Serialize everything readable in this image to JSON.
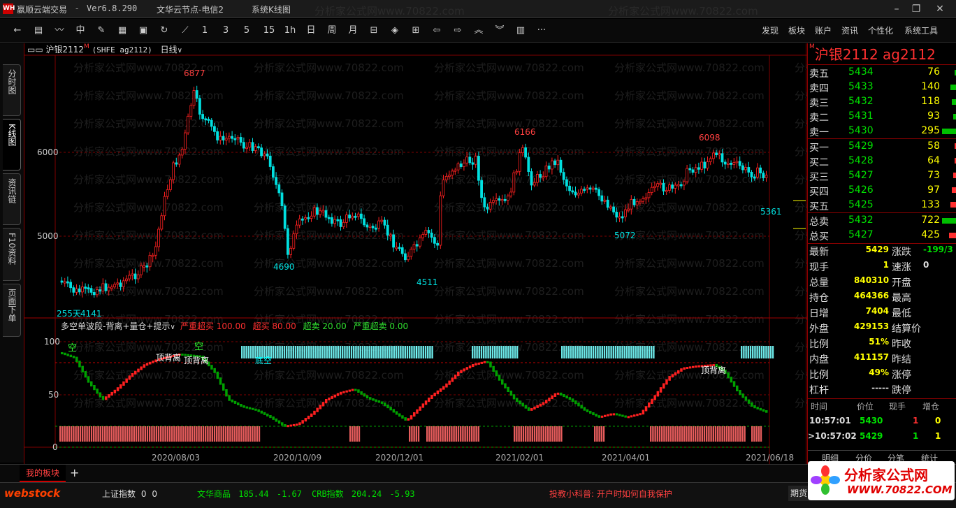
{
  "titlebar": {
    "app_name": "嬴顺云端交易",
    "version": "Ver6.8.290",
    "server": "文华云节点-电信2",
    "notice": "系统K线图",
    "watermark": "分析家公式网www.70822.com"
  },
  "toolbar": {
    "period_buttons": [
      "1",
      "3",
      "5",
      "15",
      "1h",
      "日",
      "周",
      "月"
    ],
    "right_menu": [
      "发现",
      "板块",
      "账户",
      "资讯",
      "个性化",
      "系统工具"
    ]
  },
  "sidetabs": [
    "分时图",
    "K线图",
    "资讯链",
    "F10资料",
    "页面下单"
  ],
  "chart": {
    "symbol_label": "沪银2112",
    "symbol_code": "(SHFE ag2112)",
    "period": "日线",
    "y_labels": [
      "6000",
      "5000"
    ],
    "price_marks": {
      "high_6877": "6877",
      "low_4141": "4141",
      "low_4690": "4690",
      "low_4511": "4511",
      "high_6166": "6166",
      "low_5072": "5072",
      "high_6098": "6098",
      "last_5361": "5361",
      "days": "255天"
    },
    "indicator": {
      "name": "多空单波段-背离+量仓+提示",
      "params": [
        {
          "text": "严重超买 100.00",
          "color": "#ff3030"
        },
        {
          "text": "超买 80.00",
          "color": "#ff3030"
        },
        {
          "text": "超卖 20.00",
          "color": "#30e030"
        },
        {
          "text": "严重超卖 0.00",
          "color": "#30e030"
        }
      ],
      "y_labels": [
        "100",
        "50",
        "0"
      ],
      "annotations": [
        "空",
        "空",
        "顶背离",
        "顶背离",
        "顶背离",
        "底空"
      ]
    },
    "dates": [
      "2020/08/03",
      "2020/10/09",
      "2020/12/01",
      "2021/02/01",
      "2021/04/01",
      "2021/06/18"
    ]
  },
  "quote": {
    "title": "沪银2112  ag2112",
    "asks": [
      {
        "label": "卖五",
        "price": "5434",
        "vol": "76"
      },
      {
        "label": "卖四",
        "price": "5433",
        "vol": "140"
      },
      {
        "label": "卖三",
        "price": "5432",
        "vol": "118"
      },
      {
        "label": "卖二",
        "price": "5431",
        "vol": "93"
      },
      {
        "label": "卖一",
        "price": "5430",
        "vol": "295"
      }
    ],
    "bids": [
      {
        "label": "买一",
        "price": "5429",
        "vol": "58"
      },
      {
        "label": "买二",
        "price": "5428",
        "vol": "64"
      },
      {
        "label": "买三",
        "price": "5427",
        "vol": "73"
      },
      {
        "label": "买四",
        "price": "5426",
        "vol": "97"
      },
      {
        "label": "买五",
        "price": "5425",
        "vol": "133"
      }
    ],
    "totals": [
      {
        "label": "总卖",
        "price": "5432",
        "vol": "722"
      },
      {
        "label": "总买",
        "price": "5427",
        "vol": "425"
      }
    ],
    "stats": [
      {
        "l": "最新",
        "v": "5429",
        "vc": "#ffff00",
        "l2": "涨跌",
        "v2": "-199/3",
        "v2c": "#00e000"
      },
      {
        "l": "现手",
        "v": "1",
        "vc": "#ffff00",
        "l2": "速涨",
        "v2": "0",
        "v2c": "#ddd"
      },
      {
        "l": "总量",
        "v": "840310",
        "vc": "#ffff00",
        "l2": "开盘",
        "v2": "",
        "v2c": "#ddd"
      },
      {
        "l": "持仓",
        "v": "464366",
        "vc": "#ffff00",
        "l2": "最高",
        "v2": "",
        "v2c": "#ddd"
      },
      {
        "l": "日增",
        "v": "7404",
        "vc": "#ffff00",
        "l2": "最低",
        "v2": "",
        "v2c": "#ddd"
      },
      {
        "l": "外盘",
        "v": "429153",
        "vc": "#ffff00",
        "l2": "结算价",
        "v2": "",
        "v2c": "#ddd"
      },
      {
        "l": "比例",
        "v": "51%",
        "vc": "#ffff00",
        "l2": "昨收",
        "v2": "",
        "v2c": "#ddd"
      },
      {
        "l": "内盘",
        "v": "411157",
        "vc": "#ffff00",
        "l2": "昨结",
        "v2": "",
        "v2c": "#ddd"
      },
      {
        "l": "比例",
        "v": "49%",
        "vc": "#ffff00",
        "l2": "涨停",
        "v2": "",
        "v2c": "#ddd"
      },
      {
        "l": "杠杆",
        "v": "-----",
        "vc": "#ddd",
        "l2": "跌停",
        "v2": "",
        "v2c": "#ddd"
      }
    ],
    "tick_headers": [
      "时间",
      "价位",
      "现手",
      "增仓"
    ],
    "ticks": [
      {
        "time": "10:57:01",
        "price": "5430",
        "vol": "1",
        "chg": "0"
      },
      {
        "time": ">10:57:02",
        "price": "5429",
        "vol": "1",
        "chg": "1"
      }
    ],
    "bottom_tabs": [
      "明细",
      "分价",
      "分笔",
      "统计"
    ]
  },
  "bottombar": {
    "tab": "我的板块",
    "add": "+"
  },
  "statusbar": {
    "brand": "webstock",
    "index1_name": "上证指数",
    "index1_val": "0",
    "index1_chg": "0",
    "index2_name": "文华商品",
    "index2_val": "185.44",
    "index2_chg": "-1.67",
    "index3_name": "CRB指数",
    "index3_val": "204.24",
    "index3_chg": "-5.93",
    "tip": "投教小科普: 开户时如何自我保护",
    "right_btn": "期货",
    "banner_title": "分析家公式网",
    "banner_url": "WWW.70822.COM"
  },
  "colors": {
    "up": "#ff2020",
    "down": "#00e0e0",
    "grid": "#800000",
    "indicator_up": "#ff2020",
    "indicator_down": "#00a000"
  }
}
